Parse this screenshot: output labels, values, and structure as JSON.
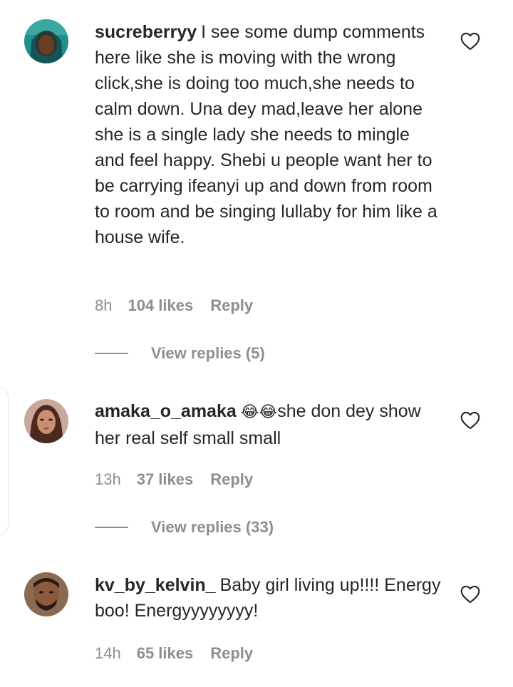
{
  "comments": [
    {
      "username": "sucreberryy",
      "text": "I see some dump comments here like she is moving with the wrong click,she is doing too much,she needs to calm down. Una dey mad,leave her alone she is a single lady she needs to mingle and feel happy. Shebi u people want her to be carrying ifeanyi up and down from room to room and be singing lullaby for him like a house wife.",
      "time": "8h",
      "likes": "104 likes",
      "reply_label": "Reply",
      "view_replies": "View replies (5)",
      "avatar_icon": "profile-photo"
    },
    {
      "username": "amaka_o_amaka",
      "emoji": "😂😂",
      "text": "she don dey show her real self small small",
      "time": "13h",
      "likes": "37 likes",
      "reply_label": "Reply",
      "view_replies": "View replies (33)",
      "avatar_icon": "profile-photo"
    },
    {
      "username": "kv_by_kelvin_",
      "text": "Baby girl living up!!!! Energy boo! Energyyyyyyyy!",
      "time": "14h",
      "likes": "65 likes",
      "reply_label": "Reply",
      "avatar_icon": "profile-photo"
    }
  ],
  "colors": {
    "text": "#262626",
    "muted": "#8e8e8e",
    "background": "#ffffff"
  }
}
